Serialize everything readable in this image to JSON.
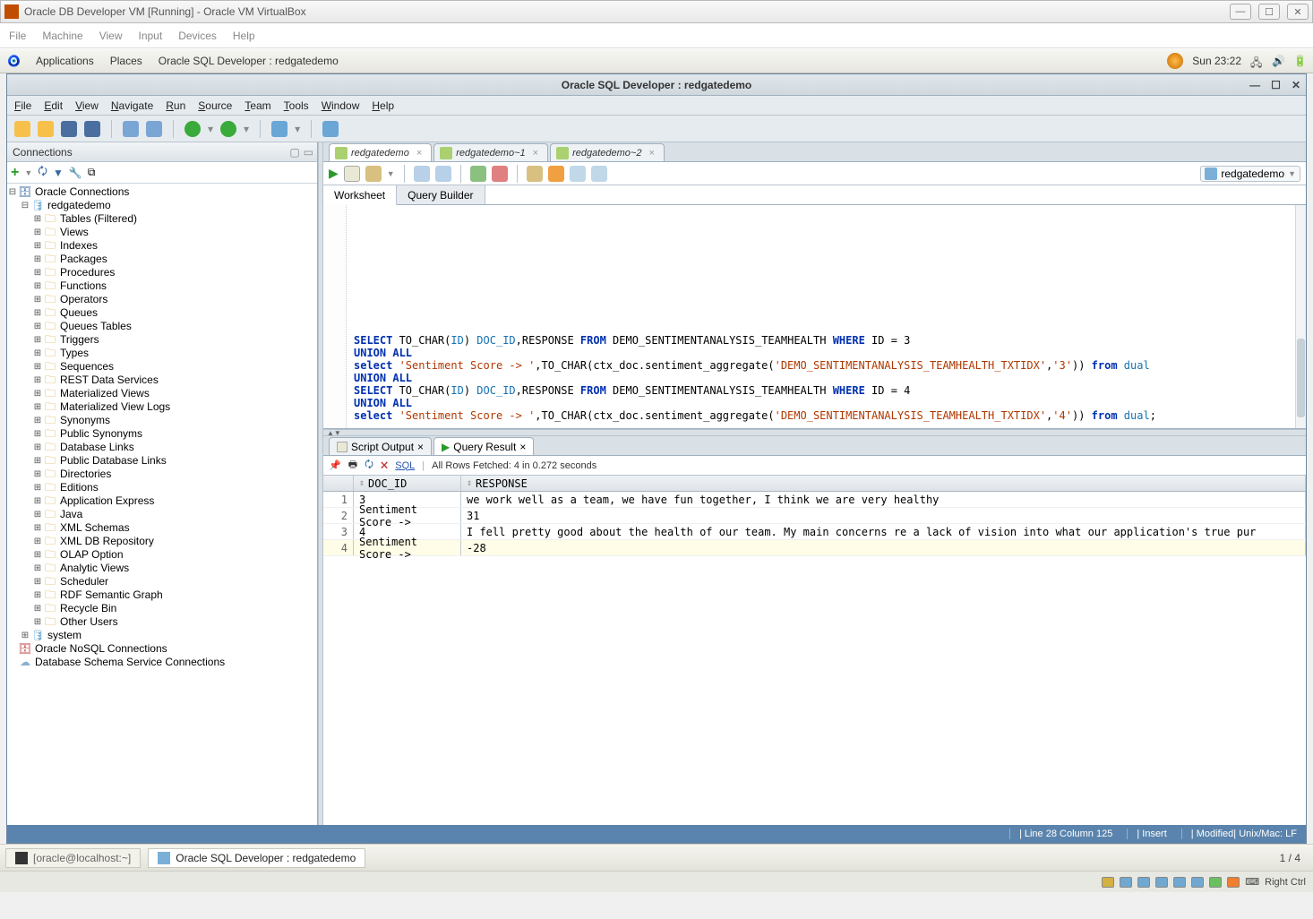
{
  "vbox": {
    "title": "Oracle DB Developer VM [Running] - Oracle VM VirtualBox",
    "menus": [
      "File",
      "Machine",
      "View",
      "Input",
      "Devices",
      "Help"
    ]
  },
  "gnome": {
    "apps": "Applications",
    "places": "Places",
    "active_window": "Oracle SQL Developer : redgatedemo",
    "clock": "Sun 23:22"
  },
  "sqldev": {
    "title": "Oracle SQL Developer : redgatedemo",
    "menus": [
      "File",
      "Edit",
      "View",
      "Navigate",
      "Run",
      "Source",
      "Team",
      "Tools",
      "Window",
      "Help"
    ],
    "conn_panel_title": "Connections",
    "tree": {
      "root": "Oracle Connections",
      "conn": "redgatedemo",
      "nodes": [
        "Tables (Filtered)",
        "Views",
        "Indexes",
        "Packages",
        "Procedures",
        "Functions",
        "Operators",
        "Queues",
        "Queues Tables",
        "Triggers",
        "Types",
        "Sequences",
        "REST Data Services",
        "Materialized Views",
        "Materialized View Logs",
        "Synonyms",
        "Public Synonyms",
        "Database Links",
        "Public Database Links",
        "Directories",
        "Editions",
        "Application Express",
        "Java",
        "XML Schemas",
        "XML DB Repository",
        "OLAP Option",
        "Analytic Views",
        "Scheduler",
        "RDF Semantic Graph",
        "Recycle Bin",
        "Other Users"
      ],
      "other_conn": "system",
      "nosql": "Oracle NoSQL Connections",
      "schema_svc": "Database Schema Service Connections"
    },
    "tabs": [
      {
        "label": "redgatedemo",
        "active": true
      },
      {
        "label": "redgatedemo~1",
        "active": false
      },
      {
        "label": "redgatedemo~2",
        "active": false
      }
    ],
    "right_db": "redgatedemo",
    "subtabs": {
      "worksheet": "Worksheet",
      "qb": "Query Builder"
    },
    "sql_blocks": [
      {
        "id": "3"
      },
      {
        "id": "4"
      }
    ],
    "sql_common": {
      "select": "SELECT",
      "to_char": "TO_CHAR",
      "doc_id": "DOC_ID",
      "response_kw": ",RESPONSE ",
      "from": "FROM",
      "table": " DEMO_SENTIMENTANALYSIS_TEAMHEALTH ",
      "where": "WHERE",
      "id_eq": " ID = ",
      "union": "UNION ALL",
      "select2": "select ",
      "lit": "'Sentiment Score -> '",
      "fn": "ctx_doc.sentiment_aggregate",
      "idx": "'DEMO_SENTIMENTANALYSIS_TEAMHEALTH_TXTIDX'",
      "from2": " from ",
      "dual": "dual"
    },
    "result_tabs": {
      "script": "Script Output",
      "query": "Query Result"
    },
    "fetch_info": "All Rows Fetched: 4 in 0.272 seconds",
    "sql_link": "SQL",
    "grid": {
      "cols": {
        "docid": "DOC_ID",
        "response": "RESPONSE"
      },
      "rows": [
        {
          "n": "1",
          "docid": "3",
          "resp": "we work well as a team, we have fun together, I think we are very healthy"
        },
        {
          "n": "2",
          "docid": "Sentiment Score -> ",
          "resp": "31"
        },
        {
          "n": "3",
          "docid": "4",
          "resp": "I fell pretty good about the health of our team. My main concerns re a lack of vision into what our application's true pur"
        },
        {
          "n": "4",
          "docid": "Sentiment Score -> ",
          "resp": "-28"
        }
      ]
    },
    "status": {
      "pos": "Line 28 Column 125",
      "ins": "Insert",
      "mod": "Modified",
      "enc": "Unix/Mac: LF"
    }
  },
  "taskbar": {
    "term": "[oracle@localhost:~]",
    "app": "Oracle SQL Developer : redgatedemo",
    "wkspace": "1 / 4"
  },
  "vbox_bottom": {
    "ctrl": "Right Ctrl"
  }
}
